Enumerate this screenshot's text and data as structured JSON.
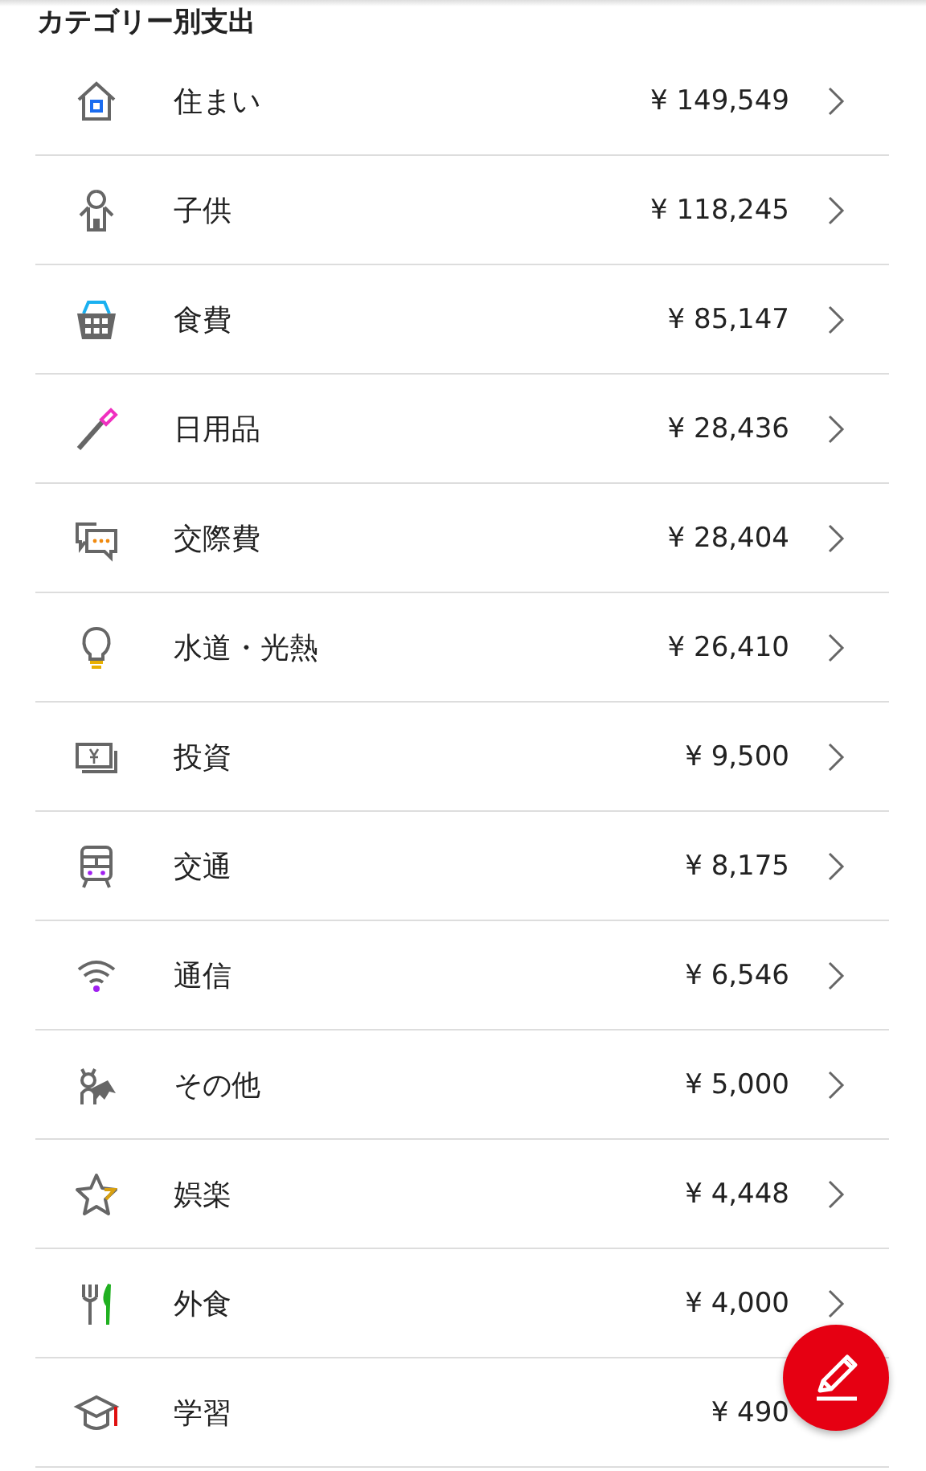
{
  "title": "カテゴリー別支出",
  "categories": [
    {
      "name": "住まい",
      "amount": "¥ 149,549"
    },
    {
      "name": "子供",
      "amount": "¥ 118,245"
    },
    {
      "name": "食費",
      "amount": "¥ 85,147"
    },
    {
      "name": "日用品",
      "amount": "¥ 28,436"
    },
    {
      "name": "交際費",
      "amount": "¥ 28,404"
    },
    {
      "name": "水道・光熱",
      "amount": "¥ 26,410"
    },
    {
      "name": "投資",
      "amount": "¥ 9,500"
    },
    {
      "name": "交通",
      "amount": "¥ 8,175"
    },
    {
      "name": "通信",
      "amount": "¥ 6,546"
    },
    {
      "name": "その他",
      "amount": "¥ 5,000"
    },
    {
      "name": "娯楽",
      "amount": "¥ 4,448"
    },
    {
      "name": "外食",
      "amount": "¥ 4,000"
    },
    {
      "name": "学習",
      "amount": "¥ 490"
    }
  ]
}
